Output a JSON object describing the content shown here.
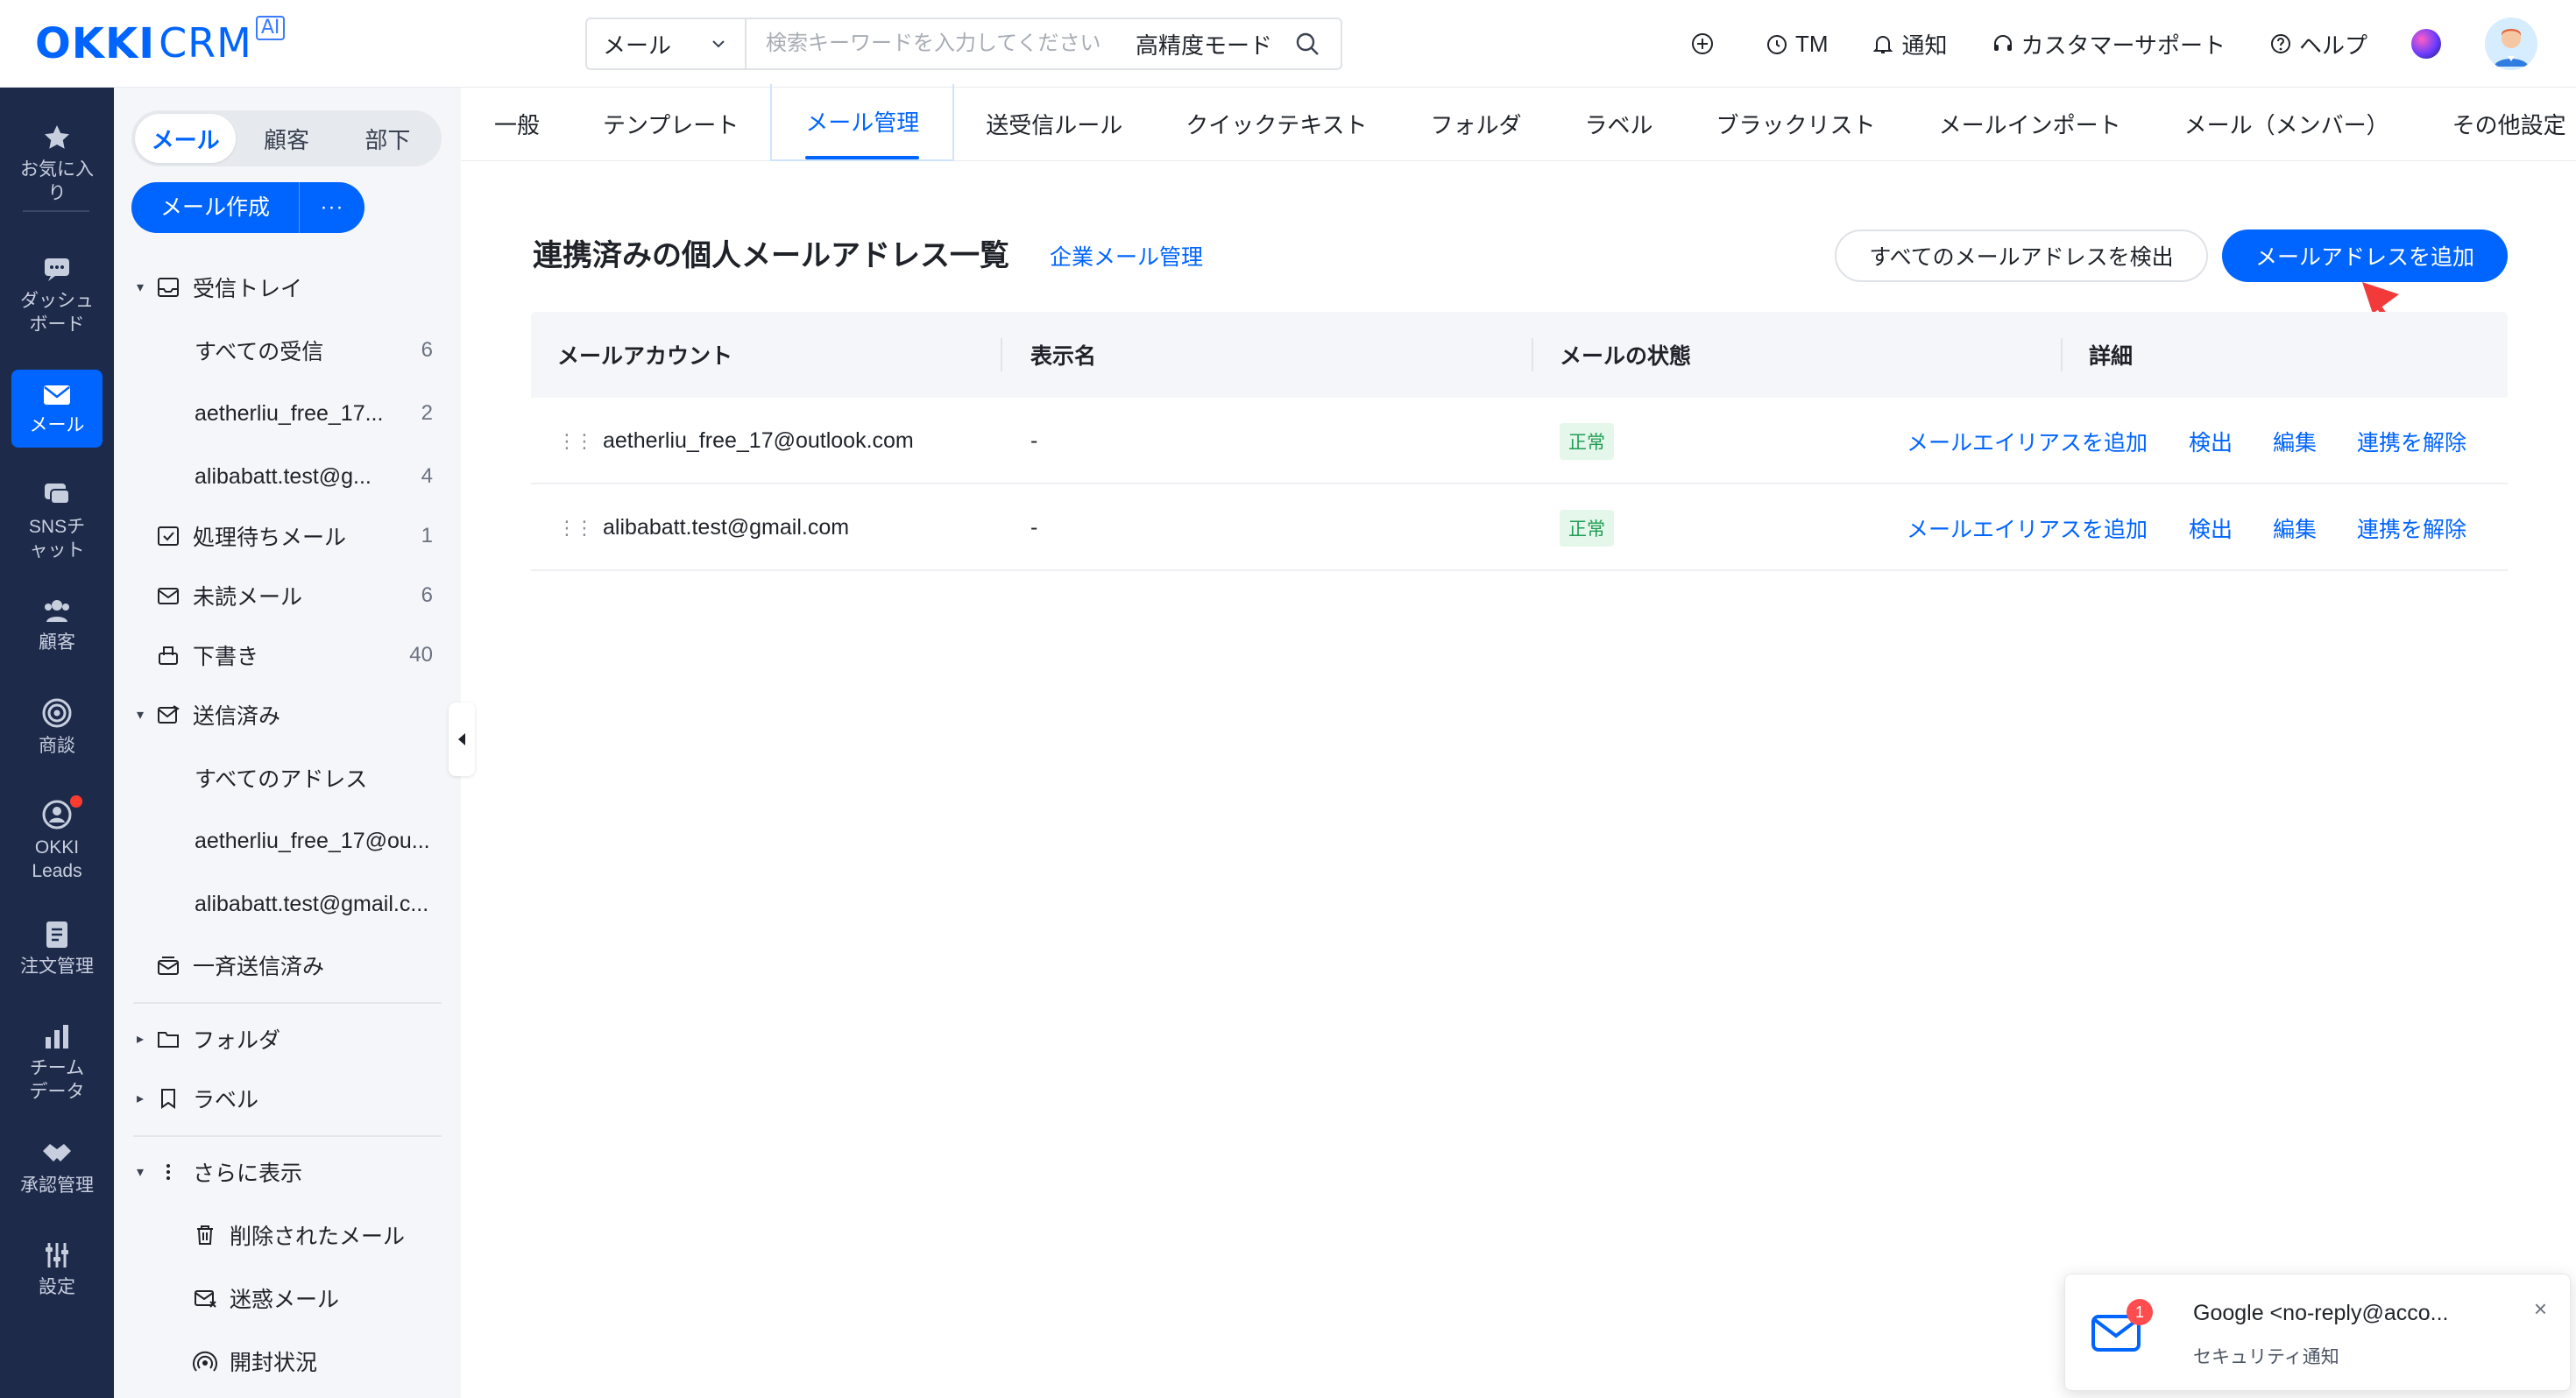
{
  "header": {
    "logo_okki": "OKKI",
    "logo_crm": "CRM",
    "logo_ai": "AI",
    "search": {
      "scope": "メール",
      "placeholder": "検索キーワードを入力してください",
      "mode": "高精度モード"
    },
    "actions": [
      {
        "label": "",
        "icon": "plus-circle-icon"
      },
      {
        "label": "TM",
        "icon": "tm-clock-icon"
      },
      {
        "label": "通知",
        "icon": "bell-icon"
      },
      {
        "label": "カスタマーサポート",
        "icon": "headset-icon"
      },
      {
        "label": "ヘルプ",
        "icon": "help-icon"
      }
    ]
  },
  "leftnav": {
    "items": [
      {
        "label": "お気に入り",
        "icon": "star-icon"
      },
      {
        "label": "ダッシュボード",
        "icon": "dashboard-icon"
      },
      {
        "label": "メール",
        "icon": "mail-icon",
        "active": true
      },
      {
        "label": "SNSチャット",
        "icon": "chat-icon"
      },
      {
        "label": "顧客",
        "icon": "customers-icon"
      },
      {
        "label": "商談",
        "icon": "target-icon"
      },
      {
        "label": "OKKI Leads",
        "icon": "leads-icon",
        "dot": true
      },
      {
        "label": "注文管理",
        "icon": "order-icon"
      },
      {
        "label": "チームデータ",
        "icon": "bar-chart-icon"
      },
      {
        "label": "承認管理",
        "icon": "handshake-icon"
      },
      {
        "label": "設定",
        "icon": "settings-icon"
      }
    ]
  },
  "sidebar": {
    "segments": [
      "メール",
      "顧客",
      "部下"
    ],
    "compose": "メール作成",
    "compose_more": "···",
    "tree": {
      "inbox": "受信トレイ",
      "inbox_all": "すべての受信",
      "inbox_all_count": "6",
      "inbox_acc1": "aetherliu_free_17...",
      "inbox_acc1_count": "2",
      "inbox_acc2": "alibabatt.test@g...",
      "inbox_acc2_count": "4",
      "pending": "処理待ちメール",
      "pending_count": "1",
      "unread": "未読メール",
      "unread_count": "6",
      "drafts": "下書き",
      "drafts_count": "40",
      "sent": "送信済み",
      "sent_all": "すべてのアドレス",
      "sent_acc1": "aetherliu_free_17@ou...",
      "sent_acc2": "alibabatt.test@gmail.c...",
      "bulk_sent": "一斉送信済み",
      "folders": "フォルダ",
      "labels": "ラベル",
      "more": "さらに表示",
      "deleted": "削除されたメール",
      "spam": "迷惑メール",
      "opens": "開封状況"
    }
  },
  "tabs": [
    "一般",
    "テンプレート",
    "メール管理",
    "送受信ルール",
    "クイックテキスト",
    "フォルダ",
    "ラベル",
    "ブラックリスト",
    "メールインポート",
    "メール（メンバー）",
    "その他設定"
  ],
  "main": {
    "title": "連携済みの個人メールアドレス一覧",
    "title_link": "企業メール管理",
    "btn_detect": "すべてのメールアドレスを検出",
    "btn_add": "メールアドレスを追加",
    "columns": [
      "メールアカウント",
      "表示名",
      "メールの状態",
      "詳細"
    ],
    "rows": [
      {
        "account": "aetherliu_free_17@outlook.com",
        "display": "-",
        "status": "正常",
        "actions": [
          "メールエイリアスを追加",
          "検出",
          "編集",
          "連携を解除"
        ]
      },
      {
        "account": "alibabatt.test@gmail.com",
        "display": "-",
        "status": "正常",
        "actions": [
          "メールエイリアスを追加",
          "検出",
          "編集",
          "連携を解除"
        ]
      }
    ]
  },
  "toast": {
    "badge": "1",
    "title": "Google <no-reply@acco...",
    "subtitle": "セキュリティ通知",
    "close": "×"
  },
  "colors": {
    "primary": "#0064ff",
    "nav_bg": "#1e2a4a",
    "sidebar_bg": "#f4f6f9",
    "status_green": "#1f9d55",
    "arrow_red": "#f23a3a"
  }
}
